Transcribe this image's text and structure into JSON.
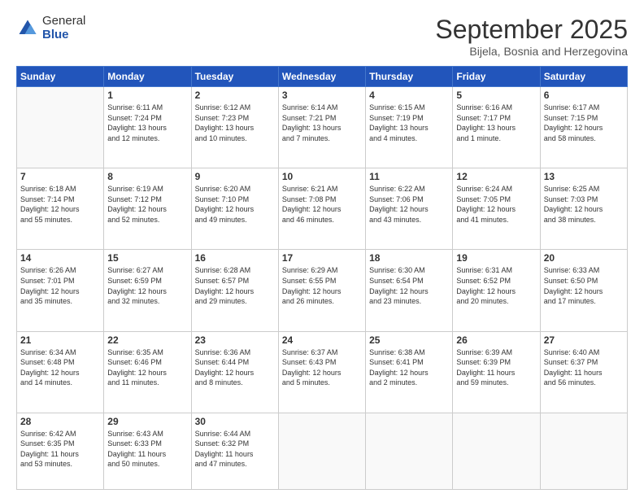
{
  "logo": {
    "general": "General",
    "blue": "Blue"
  },
  "header": {
    "title": "September 2025",
    "subtitle": "Bijela, Bosnia and Herzegovina"
  },
  "weekdays": [
    "Sunday",
    "Monday",
    "Tuesday",
    "Wednesday",
    "Thursday",
    "Friday",
    "Saturday"
  ],
  "weeks": [
    [
      {
        "day": "",
        "info": ""
      },
      {
        "day": "1",
        "info": "Sunrise: 6:11 AM\nSunset: 7:24 PM\nDaylight: 13 hours\nand 12 minutes."
      },
      {
        "day": "2",
        "info": "Sunrise: 6:12 AM\nSunset: 7:23 PM\nDaylight: 13 hours\nand 10 minutes."
      },
      {
        "day": "3",
        "info": "Sunrise: 6:14 AM\nSunset: 7:21 PM\nDaylight: 13 hours\nand 7 minutes."
      },
      {
        "day": "4",
        "info": "Sunrise: 6:15 AM\nSunset: 7:19 PM\nDaylight: 13 hours\nand 4 minutes."
      },
      {
        "day": "5",
        "info": "Sunrise: 6:16 AM\nSunset: 7:17 PM\nDaylight: 13 hours\nand 1 minute."
      },
      {
        "day": "6",
        "info": "Sunrise: 6:17 AM\nSunset: 7:15 PM\nDaylight: 12 hours\nand 58 minutes."
      }
    ],
    [
      {
        "day": "7",
        "info": "Sunrise: 6:18 AM\nSunset: 7:14 PM\nDaylight: 12 hours\nand 55 minutes."
      },
      {
        "day": "8",
        "info": "Sunrise: 6:19 AM\nSunset: 7:12 PM\nDaylight: 12 hours\nand 52 minutes."
      },
      {
        "day": "9",
        "info": "Sunrise: 6:20 AM\nSunset: 7:10 PM\nDaylight: 12 hours\nand 49 minutes."
      },
      {
        "day": "10",
        "info": "Sunrise: 6:21 AM\nSunset: 7:08 PM\nDaylight: 12 hours\nand 46 minutes."
      },
      {
        "day": "11",
        "info": "Sunrise: 6:22 AM\nSunset: 7:06 PM\nDaylight: 12 hours\nand 43 minutes."
      },
      {
        "day": "12",
        "info": "Sunrise: 6:24 AM\nSunset: 7:05 PM\nDaylight: 12 hours\nand 41 minutes."
      },
      {
        "day": "13",
        "info": "Sunrise: 6:25 AM\nSunset: 7:03 PM\nDaylight: 12 hours\nand 38 minutes."
      }
    ],
    [
      {
        "day": "14",
        "info": "Sunrise: 6:26 AM\nSunset: 7:01 PM\nDaylight: 12 hours\nand 35 minutes."
      },
      {
        "day": "15",
        "info": "Sunrise: 6:27 AM\nSunset: 6:59 PM\nDaylight: 12 hours\nand 32 minutes."
      },
      {
        "day": "16",
        "info": "Sunrise: 6:28 AM\nSunset: 6:57 PM\nDaylight: 12 hours\nand 29 minutes."
      },
      {
        "day": "17",
        "info": "Sunrise: 6:29 AM\nSunset: 6:55 PM\nDaylight: 12 hours\nand 26 minutes."
      },
      {
        "day": "18",
        "info": "Sunrise: 6:30 AM\nSunset: 6:54 PM\nDaylight: 12 hours\nand 23 minutes."
      },
      {
        "day": "19",
        "info": "Sunrise: 6:31 AM\nSunset: 6:52 PM\nDaylight: 12 hours\nand 20 minutes."
      },
      {
        "day": "20",
        "info": "Sunrise: 6:33 AM\nSunset: 6:50 PM\nDaylight: 12 hours\nand 17 minutes."
      }
    ],
    [
      {
        "day": "21",
        "info": "Sunrise: 6:34 AM\nSunset: 6:48 PM\nDaylight: 12 hours\nand 14 minutes."
      },
      {
        "day": "22",
        "info": "Sunrise: 6:35 AM\nSunset: 6:46 PM\nDaylight: 12 hours\nand 11 minutes."
      },
      {
        "day": "23",
        "info": "Sunrise: 6:36 AM\nSunset: 6:44 PM\nDaylight: 12 hours\nand 8 minutes."
      },
      {
        "day": "24",
        "info": "Sunrise: 6:37 AM\nSunset: 6:43 PM\nDaylight: 12 hours\nand 5 minutes."
      },
      {
        "day": "25",
        "info": "Sunrise: 6:38 AM\nSunset: 6:41 PM\nDaylight: 12 hours\nand 2 minutes."
      },
      {
        "day": "26",
        "info": "Sunrise: 6:39 AM\nSunset: 6:39 PM\nDaylight: 11 hours\nand 59 minutes."
      },
      {
        "day": "27",
        "info": "Sunrise: 6:40 AM\nSunset: 6:37 PM\nDaylight: 11 hours\nand 56 minutes."
      }
    ],
    [
      {
        "day": "28",
        "info": "Sunrise: 6:42 AM\nSunset: 6:35 PM\nDaylight: 11 hours\nand 53 minutes."
      },
      {
        "day": "29",
        "info": "Sunrise: 6:43 AM\nSunset: 6:33 PM\nDaylight: 11 hours\nand 50 minutes."
      },
      {
        "day": "30",
        "info": "Sunrise: 6:44 AM\nSunset: 6:32 PM\nDaylight: 11 hours\nand 47 minutes."
      },
      {
        "day": "",
        "info": ""
      },
      {
        "day": "",
        "info": ""
      },
      {
        "day": "",
        "info": ""
      },
      {
        "day": "",
        "info": ""
      }
    ]
  ]
}
